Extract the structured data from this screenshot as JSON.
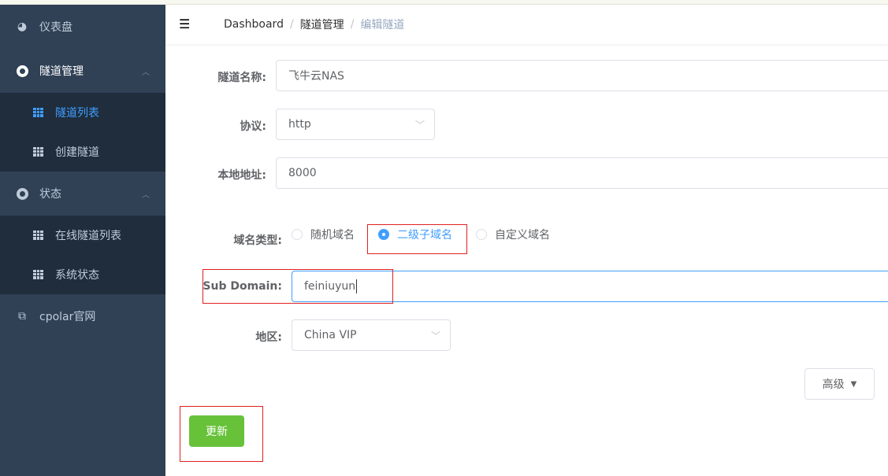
{
  "sidebar": {
    "items": [
      {
        "label": "仪表盘",
        "icon": "dashboard-icon"
      },
      {
        "label": "隧道管理",
        "icon": "lifebuoy-icon",
        "expanded": true
      },
      {
        "label": "隧道列表",
        "icon": "table-icon",
        "active": true
      },
      {
        "label": "创建隧道",
        "icon": "table-icon"
      },
      {
        "label": "状态",
        "icon": "lifebuoy-icon",
        "expanded": true
      },
      {
        "label": "在线隧道列表",
        "icon": "table-icon"
      },
      {
        "label": "系统状态",
        "icon": "table-icon"
      },
      {
        "label": "cpolar官网",
        "icon": "external-link-icon"
      }
    ]
  },
  "breadcrumb": [
    "Dashboard",
    "隧道管理",
    "编辑隧道"
  ],
  "form": {
    "name_label": "隧道名称:",
    "name_value": "飞牛云NAS",
    "protocol_label": "协议:",
    "protocol_value": "http",
    "local_label": "本地地址:",
    "local_value": "8000",
    "domain_type_label": "域名类型:",
    "domain_types": [
      "随机域名",
      "二级子域名",
      "自定义域名"
    ],
    "domain_type_selected": "二级子域名",
    "subdomain_label": "Sub Domain:",
    "subdomain_value": "feiniuyun",
    "region_label": "地区:",
    "region_value": "China VIP",
    "advanced_label": "高级",
    "update_label": "更新"
  },
  "colors": {
    "sidebar": "#304156",
    "submenu": "#1f2d3d",
    "active": "#409eff",
    "update": "#67c23a",
    "highlight": "#e02020"
  }
}
